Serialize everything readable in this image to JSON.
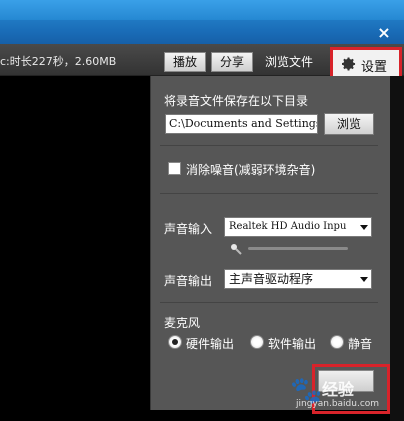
{
  "window": {
    "close_glyph": "×"
  },
  "toolbar": {
    "file_info": "c:时长227秒，2.60MB",
    "play_label": "播放",
    "share_label": "分享",
    "browse_files_label": "浏览文件",
    "settings_label": "设置"
  },
  "settings_panel": {
    "save_dir_label": "将录音文件保存在以下目录",
    "save_path": "C:\\Documents and Settings",
    "browse_label": "浏览",
    "noise_reduction": {
      "label": "消除噪音(减弱环境杂音)",
      "checked": false
    },
    "audio_input": {
      "label": "声音输入",
      "value": "Realtek HD Audio Inpu"
    },
    "audio_output": {
      "label": "声音输出",
      "value": "主声音驱动程序"
    },
    "microphone": {
      "title": "麦克风",
      "options": [
        {
          "label": "硬件输出",
          "selected": true
        },
        {
          "label": "软件输出",
          "selected": false
        },
        {
          "label": "静音",
          "selected": false
        }
      ]
    }
  },
  "watermark": {
    "brand": "经验",
    "paw": "🐾",
    "url": "jingyan.baidu.com"
  },
  "icons": {
    "settings": "gear-icon",
    "mic": "microphone-icon"
  }
}
